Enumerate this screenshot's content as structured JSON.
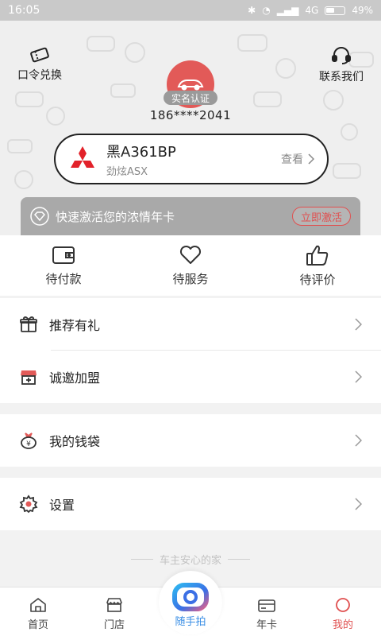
{
  "status_bar": {
    "time": "16:05",
    "network": "4G",
    "battery": "49%"
  },
  "header": {
    "voucher_label": "口令兑换",
    "contact_label": "联系我们",
    "verify_badge": "实名认证",
    "phone": "186****2041"
  },
  "car": {
    "plate": "黑A361BP",
    "model": "劲炫ASX",
    "view_label": "查看"
  },
  "promo": {
    "text": "快速激活您的浓情年卡",
    "button": "立即激活"
  },
  "orders": [
    {
      "label": "待付款",
      "icon": "wallet-icon"
    },
    {
      "label": "待服务",
      "icon": "heart-icon"
    },
    {
      "label": "待评价",
      "icon": "thumbs-up-icon"
    }
  ],
  "menu": {
    "recommend": "推荐有礼",
    "franchise": "诚邀加盟",
    "wallet": "我的钱袋",
    "settings": "设置"
  },
  "slogan": "车主安心的家",
  "tabs": {
    "home": "首页",
    "store": "门店",
    "camera": "随手拍",
    "card": "年卡",
    "mine": "我的"
  },
  "colors": {
    "accent": "#e05050",
    "avatar_bg": "#e25a58",
    "camera_blue": "#3b8fe5"
  }
}
